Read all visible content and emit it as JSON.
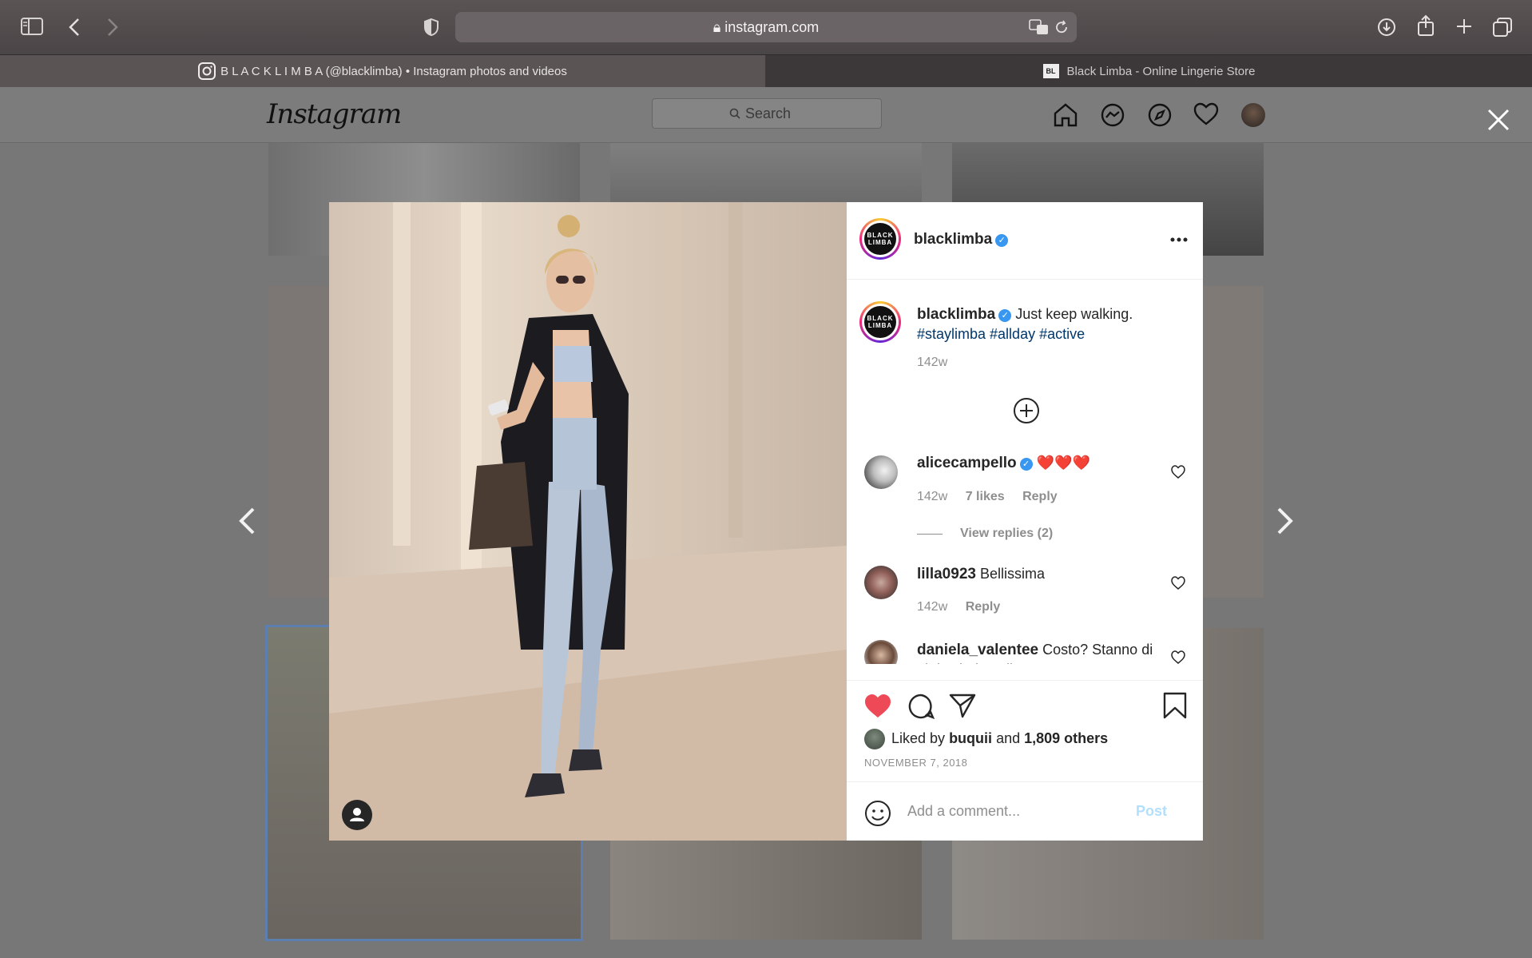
{
  "browser": {
    "url": "instagram.com",
    "tabs": [
      {
        "title": "B L A C K L I M B A (@blacklimba) • Instagram photos and videos"
      },
      {
        "title": "Black Limba - Online Lingerie Store"
      }
    ]
  },
  "instagram": {
    "logo": "Instagram",
    "search_placeholder": "Search"
  },
  "post": {
    "author": "blacklimba",
    "avatar_text": "BLACK LIMBA",
    "caption": "Just keep walking.",
    "hashtags": "#staylimba #allday #active",
    "caption_time": "142w",
    "comments": [
      {
        "user": "alicecampello",
        "text": "❤️❤️❤️",
        "time": "142w",
        "likes": "7 likes",
        "reply": "Reply",
        "view_replies": "View replies (2)"
      },
      {
        "user": "lilla0923",
        "text": "Bellissima",
        "time": "142w",
        "reply": "Reply"
      },
      {
        "user": "daniela_valentee",
        "text": "Costo? Stanno di altri colori?taglie?"
      }
    ],
    "liked_by_prefix": "Liked by",
    "liked_by_user": "buquii",
    "liked_by_mid": "and",
    "liked_by_others": "1,809 others",
    "date": "NOVEMBER 7, 2018",
    "comment_placeholder": "Add a comment...",
    "post_button": "Post"
  },
  "colors": {
    "like_red": "#ed4956",
    "verified_blue": "#3897f0",
    "post_button": "#b2dffc"
  }
}
